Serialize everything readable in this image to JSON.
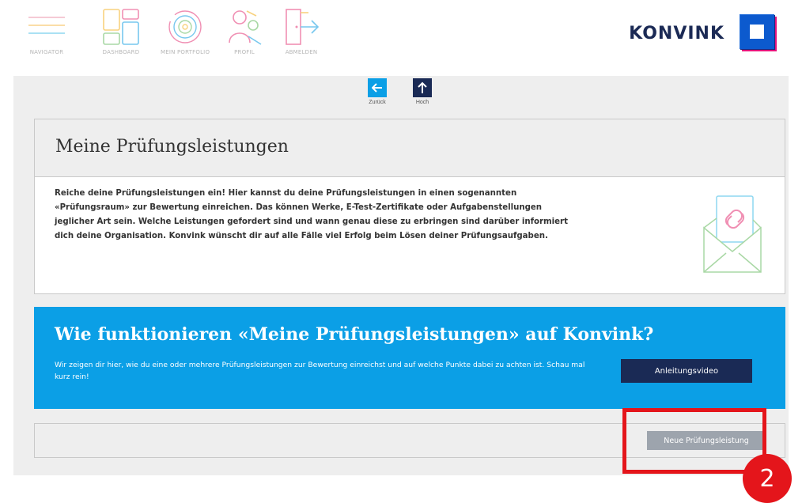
{
  "nav": {
    "items": [
      {
        "label": "NAVIGATOR",
        "icon": "hamburger-menu-icon"
      },
      {
        "label": "DASHBOARD",
        "icon": "dashboard-grid-icon"
      },
      {
        "label": "MEIN PORTFOLIO",
        "icon": "portfolio-circles-icon"
      },
      {
        "label": "PROFIL",
        "icon": "profile-person-icon"
      },
      {
        "label": "ABMELDEN",
        "icon": "logout-door-icon"
      }
    ],
    "brand": "KONVINK",
    "colors": {
      "menu_line_1": "#f2b8c7",
      "menu_line_2": "#f8d28a",
      "menu_line_3": "#8ed7f0",
      "icon_pink": "#f08fb3",
      "icon_blue": "#77c7ee",
      "icon_yellow": "#f8d27f",
      "icon_green": "#a9d8a5"
    }
  },
  "pager": {
    "back_label": "Zurück",
    "up_label": "Hoch",
    "back_icon": "arrow-left-icon",
    "up_icon": "arrow-up-icon",
    "colors": {
      "back": "#0b9fe6",
      "up": "#1a2a55"
    }
  },
  "exam": {
    "title": "Meine Prüfungsleistungen",
    "intro": "Reiche deine Prüfungsleistungen ein! Hier kannst du deine Prüfungsleistungen in einen sogenannten «Prüfungsraum» zur Bewertung einreichen. Das können Werke, E-Test-Zertifikate oder Aufgabenstellungen jeglicher Art sein. Welche Leistungen gefordert sind und wann genau diese zu erbringen sind darüber informiert dich deine Organisation. Konvink wünscht dir auf alle Fälle viel Erfolg beim Lösen deiner Prüfungsaufgaben.",
    "illustration_icon": "envelope-link-icon"
  },
  "howto": {
    "title": "Wie funktionieren «Meine Prüfungsleistungen» auf Konvink?",
    "text": "Wir zeigen dir hier, wie du eine oder mehrere Prüfungsleistungen zur Bewertung einreichst und auf welche Punkte dabei zu achten ist. Schau mal kurz rein!",
    "video_button": "Anleitungsvideo",
    "colors": {
      "background": "#0b9fe6",
      "button": "#1a2a55"
    }
  },
  "actions": {
    "new_button": "Neue Prüfungsleistung",
    "colors": {
      "button": "#9da4ad"
    }
  },
  "annotation": {
    "step": "2",
    "color": "#e4151b"
  }
}
